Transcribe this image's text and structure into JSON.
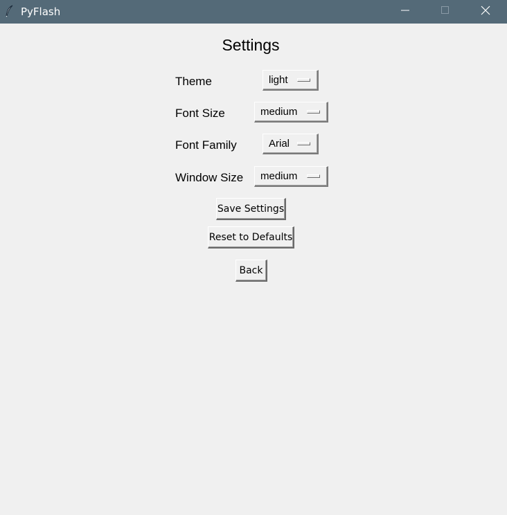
{
  "window": {
    "title": "PyFlash",
    "icon": "feather-icon",
    "controls": [
      "minimize-icon",
      "maximize-icon",
      "close-icon"
    ],
    "titlebar_color": "#546a78",
    "background_color": "#f0f0f0"
  },
  "settings": {
    "heading": "Settings",
    "fields": [
      {
        "label": "Theme",
        "value": "light"
      },
      {
        "label": "Font Size",
        "value": "medium"
      },
      {
        "label": "Font Family",
        "value": "Arial"
      },
      {
        "label": "Window Size",
        "value": "medium"
      }
    ],
    "buttons": {
      "save": "Save Settings",
      "reset": "Reset to Defaults",
      "back": "Back"
    }
  }
}
